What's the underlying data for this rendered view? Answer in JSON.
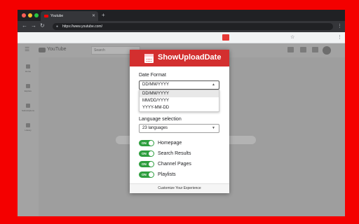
{
  "browser": {
    "tab_title": "Youtube",
    "tab_close": "✕",
    "new_tab": "+",
    "url": "https://www.youtube.com/",
    "back": "←",
    "forward": "→",
    "reload": "↻",
    "menu": "⋮",
    "star": "☆"
  },
  "youtube": {
    "logo_text": "YouTube",
    "search_placeholder": "Search",
    "menu": "☰",
    "sidebar": [
      "Home",
      "Explore",
      "Subscriptions",
      "Library"
    ]
  },
  "popup": {
    "title": "ShowUploadDate",
    "date_format_label": "Date Format",
    "date_format_value": "DD/MM/YYYY",
    "date_options": [
      "DD/MM/YYYY",
      "MM/DD/YYYY",
      "YYYY-MM-DD"
    ],
    "language_label": "Language selection",
    "language_value": "23 languages",
    "toggle_on": "ON",
    "toggles": [
      "Homepage",
      "Search Results",
      "Channel Pages",
      "Playlists"
    ],
    "footer": "Customize Your Experience"
  },
  "icons": {
    "select_arrow": "▲",
    "select_arrow_down": "▼"
  }
}
